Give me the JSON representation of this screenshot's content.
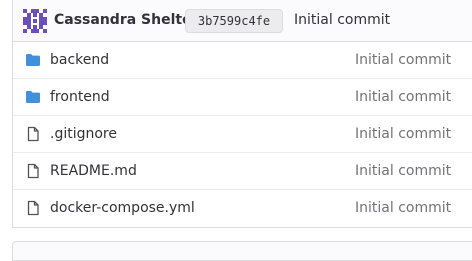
{
  "commit": {
    "author": "Cassandra Shelton",
    "sha": "3b7599c4fe",
    "message": "Initial commit",
    "avatar_color": "#6b4fbb"
  },
  "files": [
    {
      "name": "backend",
      "type": "folder",
      "icon": "folder-icon",
      "commit_message": "Initial commit"
    },
    {
      "name": "frontend",
      "type": "folder",
      "icon": "folder-icon",
      "commit_message": "Initial commit"
    },
    {
      "name": ".gitignore",
      "type": "file",
      "icon": "file-icon",
      "commit_message": "Initial commit"
    },
    {
      "name": "README.md",
      "type": "file",
      "icon": "file-icon",
      "commit_message": "Initial commit"
    },
    {
      "name": "docker-compose.yml",
      "type": "file",
      "icon": "file-icon",
      "commit_message": "Initial commit"
    }
  ],
  "colors": {
    "folder": "#428fdc",
    "file_icon": "#535158",
    "muted_text": "#737278"
  }
}
